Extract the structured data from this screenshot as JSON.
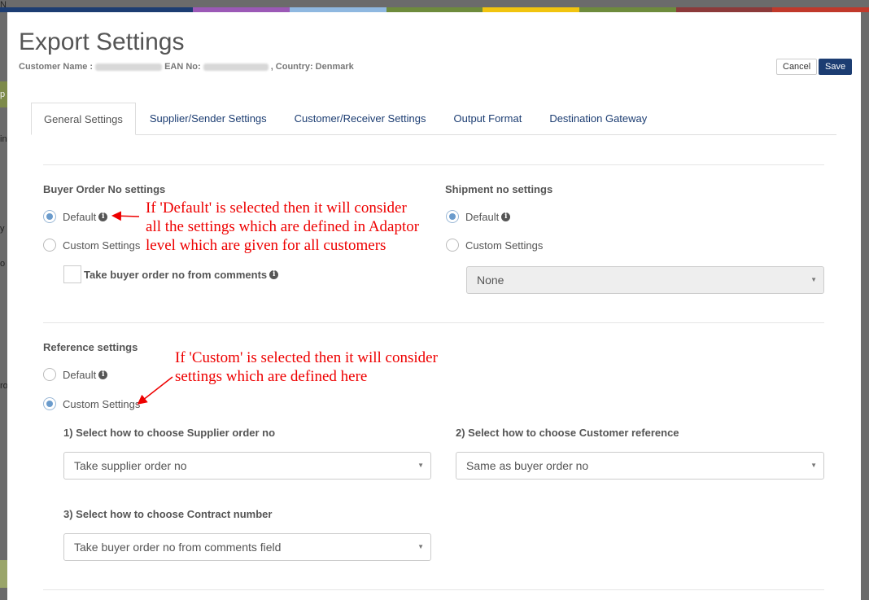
{
  "backdrop": {
    "colors": [
      "#1c3d72",
      "#1c3d72",
      "#9b59b6",
      "#8fb8e0",
      "#6e8b3d",
      "#f1c40f",
      "#6e8b3d",
      "#8b3a3a",
      "#c0392b"
    ],
    "letters": [
      "N",
      "p",
      "in",
      "y",
      "o",
      "ro"
    ]
  },
  "modal": {
    "title": "Export Settings",
    "customer_name_label": "Customer Name :",
    "ean_label": "EAN No:",
    "country_label": ", Country: Denmark",
    "cancel_label": "Cancel",
    "save_label": "Save"
  },
  "tabs": [
    {
      "label": "General Settings",
      "active": true
    },
    {
      "label": "Supplier/Sender Settings",
      "active": false
    },
    {
      "label": "Customer/Receiver Settings",
      "active": false
    },
    {
      "label": "Output Format",
      "active": false
    },
    {
      "label": "Destination Gateway",
      "active": false
    }
  ],
  "buyer_order": {
    "heading": "Buyer Order No settings",
    "default_label": "Default",
    "custom_label": "Custom Settings",
    "selected": "default",
    "checkbox_label": "Take buyer order no from comments",
    "checkbox_checked": false
  },
  "shipment": {
    "heading": "Shipment no settings",
    "default_label": "Default",
    "custom_label": "Custom Settings",
    "selected": "default",
    "select_value": "None"
  },
  "reference": {
    "heading": "Reference settings",
    "default_label": "Default",
    "custom_label": "Custom Settings",
    "selected": "custom",
    "q1_label": "1) Select how to choose Supplier order no",
    "q1_value": "Take supplier order no",
    "q2_label": "2) Select how to choose Customer reference",
    "q2_value": "Same as buyer order no",
    "q3_label": "3) Select how to choose Contract number",
    "q3_value": "Take buyer order no from comments field"
  },
  "annotations": {
    "default_note": [
      "If 'Default' is selected then it will consider",
      "all the settings which are defined in Adaptor",
      "level which are given for all customers"
    ],
    "custom_note": [
      "If  'Custom' is selected then it will consider",
      "settings which are defined here"
    ],
    "color": "#e00000"
  },
  "icons": {
    "info": "info-circle-icon",
    "caret": "caret-down-icon"
  }
}
